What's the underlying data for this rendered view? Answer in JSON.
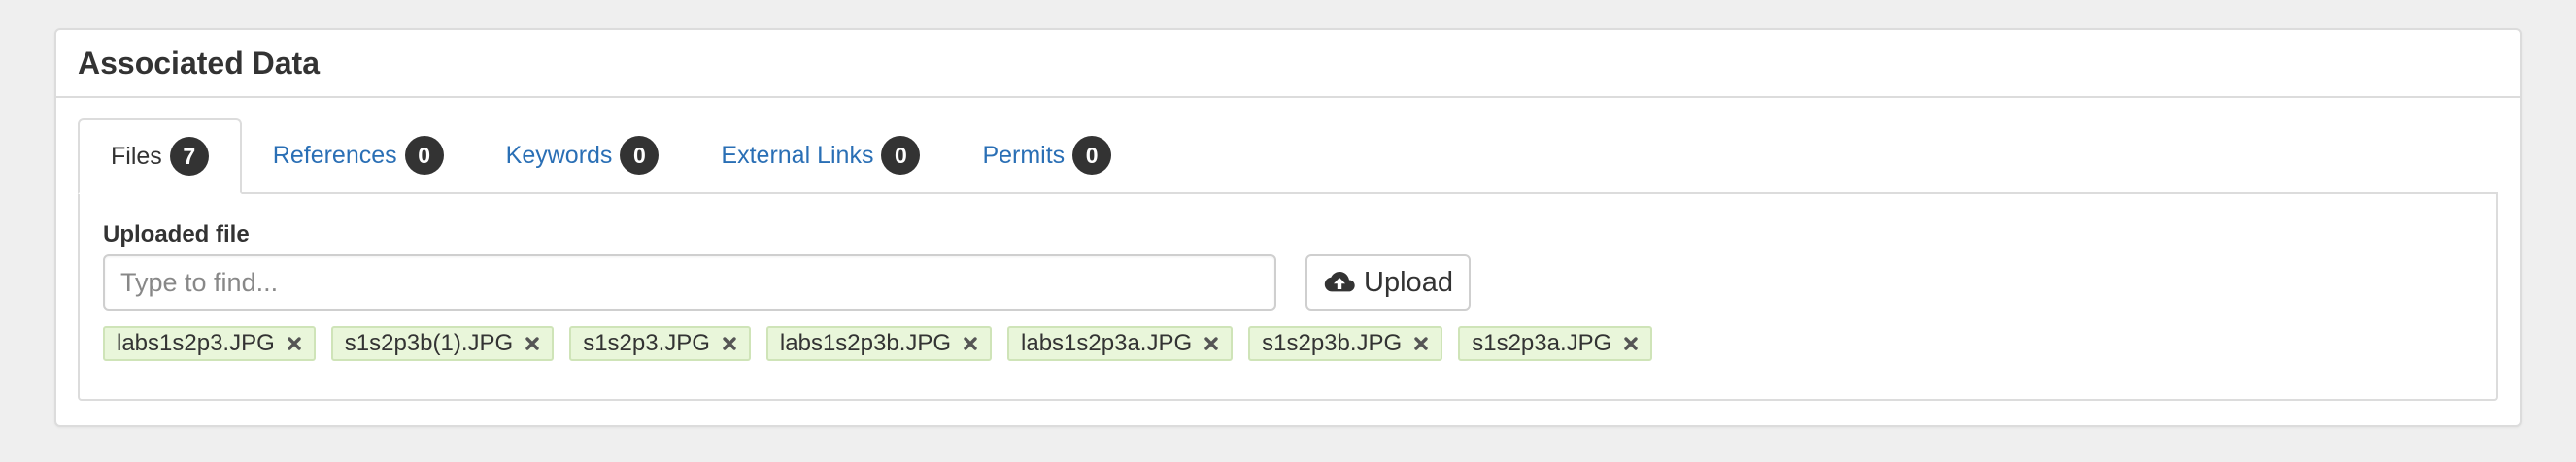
{
  "panel": {
    "title": "Associated Data"
  },
  "tabs": [
    {
      "label": "Files",
      "count": "7",
      "active": true
    },
    {
      "label": "References",
      "count": "0",
      "active": false
    },
    {
      "label": "Keywords",
      "count": "0",
      "active": false
    },
    {
      "label": "External Links",
      "count": "0",
      "active": false
    },
    {
      "label": "Permits",
      "count": "0",
      "active": false
    }
  ],
  "files": {
    "field_label": "Uploaded file",
    "search_placeholder": "Type to find...",
    "search_value": "",
    "upload_label": "Upload",
    "upload_icon": "cloud-upload-icon",
    "remove_icon": "close-icon",
    "items": [
      "labs1s2p3.JPG",
      "s1s2p3b(1).JPG",
      "s1s2p3.JPG",
      "labs1s2p3b.JPG",
      "labs1s2p3a.JPG",
      "s1s2p3b.JPG",
      "s1s2p3a.JPG"
    ]
  },
  "colors": {
    "link": "#2a6fb5",
    "badge_bg": "#333333",
    "tag_bg": "#e9f6da",
    "tag_border": "#cfe4b8",
    "remove_icon": "#555555"
  }
}
